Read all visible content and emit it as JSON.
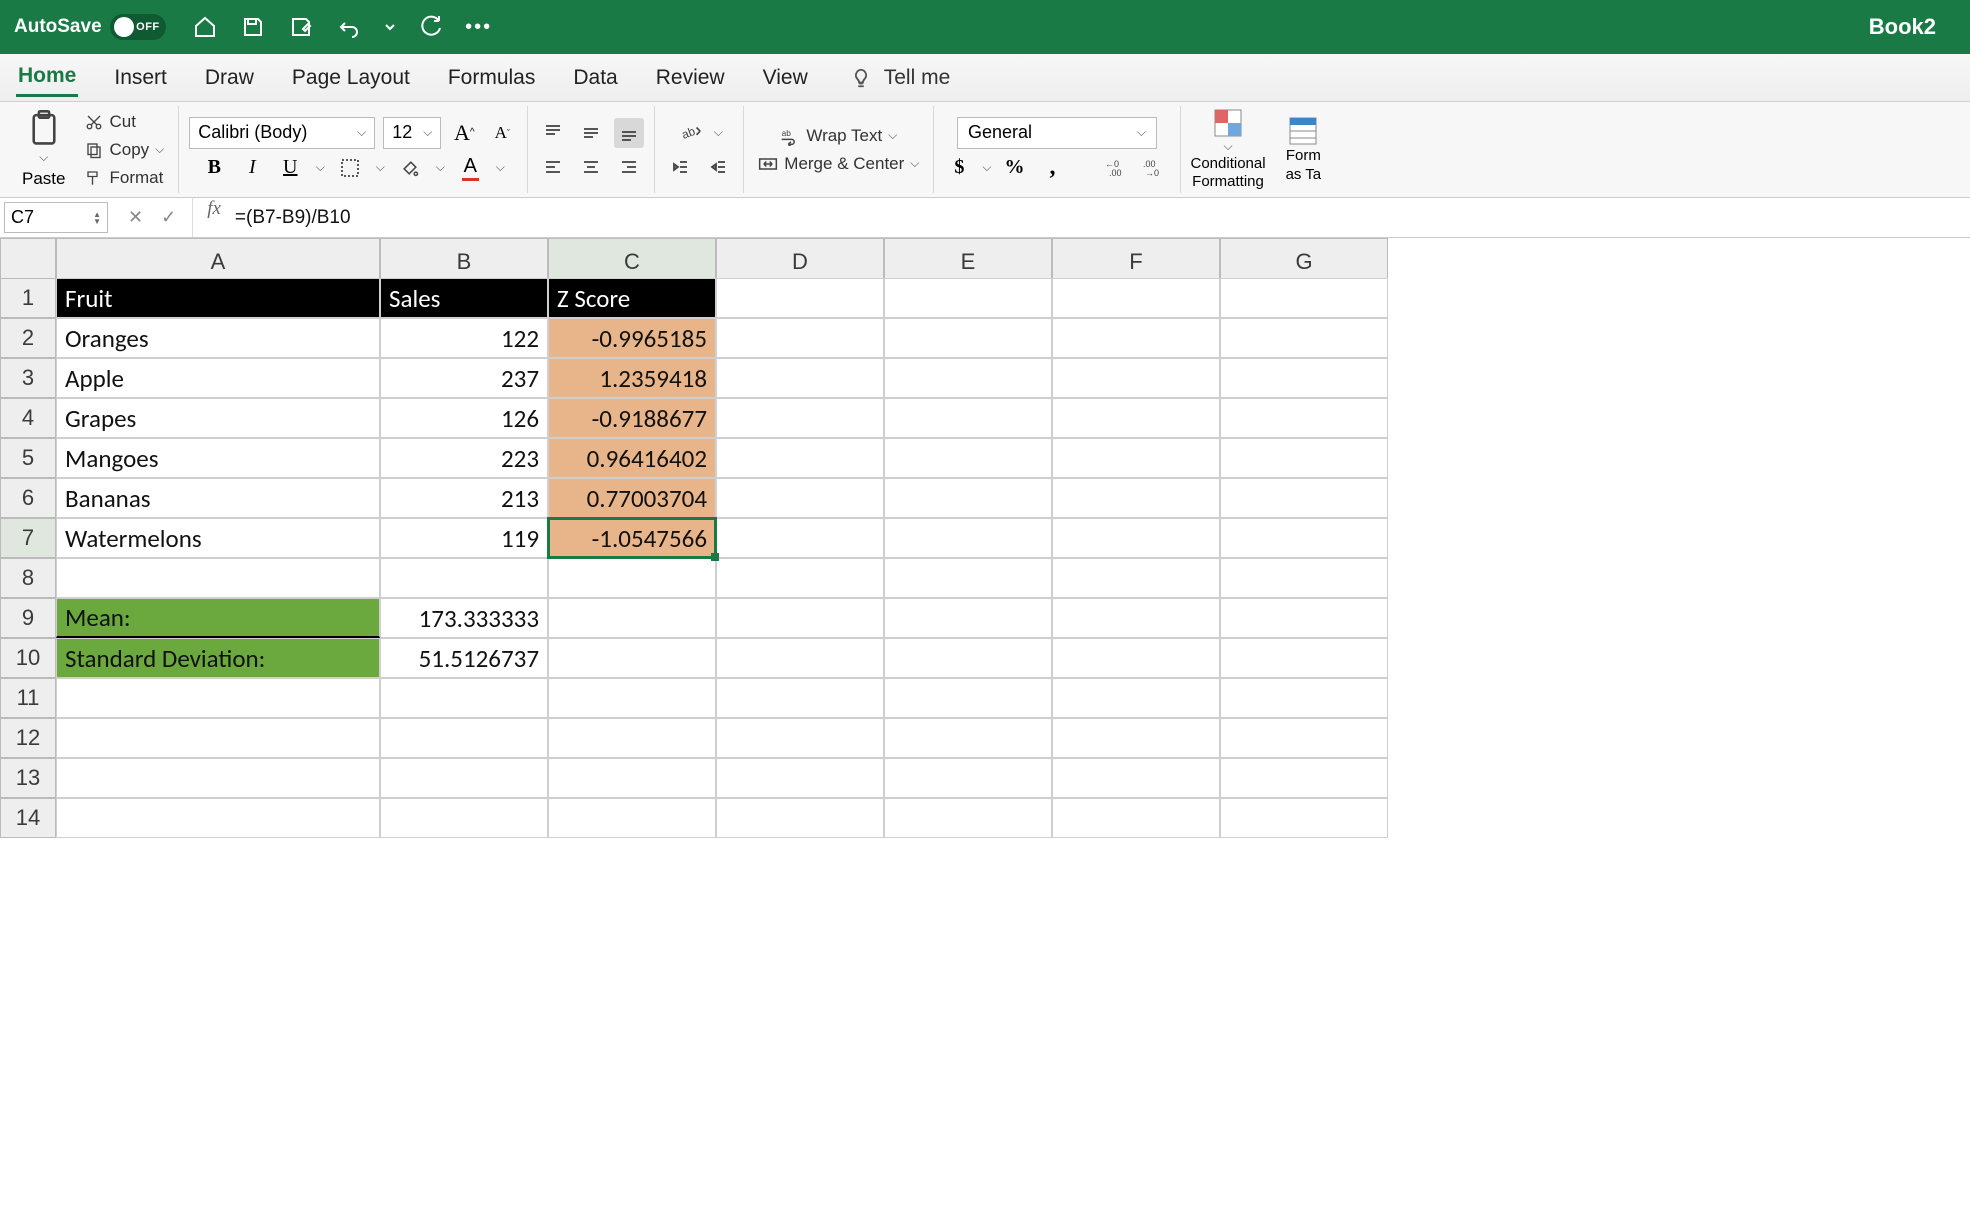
{
  "titlebar": {
    "autosave_label": "AutoSave",
    "autosave_state": "OFF",
    "book_title": "Book2"
  },
  "tabs": {
    "items": [
      "Home",
      "Insert",
      "Draw",
      "Page Layout",
      "Formulas",
      "Data",
      "Review",
      "View"
    ],
    "active": "Home",
    "tell_me": "Tell me"
  },
  "ribbon": {
    "paste": "Paste",
    "cut": "Cut",
    "copy": "Copy",
    "format": "Format",
    "font_name": "Calibri (Body)",
    "font_size": "12",
    "wrap_text": "Wrap Text",
    "merge_center": "Merge & Center",
    "number_format": "General",
    "conditional_formatting_1": "Conditional",
    "conditional_formatting_2": "Formatting",
    "format_as_1": "Form",
    "format_as_2": "as Ta"
  },
  "formula_bar": {
    "cell_ref": "C7",
    "formula": "=(B7-B9)/B10"
  },
  "sheet": {
    "columns": [
      "A",
      "B",
      "C",
      "D",
      "E",
      "F",
      "G"
    ],
    "selected_col": "C",
    "selected_row": "7",
    "header": {
      "a": "Fruit",
      "b": "Sales",
      "c": "Z Score"
    },
    "rows": [
      {
        "n": "2",
        "a": "Oranges",
        "b": "122",
        "c": "-0.9965185"
      },
      {
        "n": "3",
        "a": "Apple",
        "b": "237",
        "c": "1.2359418"
      },
      {
        "n": "4",
        "a": "Grapes",
        "b": "126",
        "c": "-0.9188677"
      },
      {
        "n": "5",
        "a": "Mangoes",
        "b": "223",
        "c": "0.96416402"
      },
      {
        "n": "6",
        "a": "Bananas",
        "b": "213",
        "c": "0.77003704"
      },
      {
        "n": "7",
        "a": "Watermelons",
        "b": "119",
        "c": "-1.0547566"
      }
    ],
    "stats": {
      "mean_label": "Mean:",
      "mean_value": "173.333333",
      "std_label": "Standard Deviation:",
      "std_value": "51.5126737"
    },
    "empty_rows": [
      "8",
      "11",
      "12",
      "13",
      "14"
    ]
  },
  "chart_data": {
    "type": "table",
    "title": "Fruit Sales and Z Scores",
    "columns": [
      "Fruit",
      "Sales",
      "Z Score"
    ],
    "records": [
      {
        "Fruit": "Oranges",
        "Sales": 122,
        "Z Score": -0.9965185
      },
      {
        "Fruit": "Apple",
        "Sales": 237,
        "Z Score": 1.2359418
      },
      {
        "Fruit": "Grapes",
        "Sales": 126,
        "Z Score": -0.9188677
      },
      {
        "Fruit": "Mangoes",
        "Sales": 223,
        "Z Score": 0.96416402
      },
      {
        "Fruit": "Bananas",
        "Sales": 213,
        "Z Score": 0.77003704
      },
      {
        "Fruit": "Watermelons",
        "Sales": 119,
        "Z Score": -1.0547566
      }
    ],
    "summary": {
      "Mean": 173.333333,
      "Standard Deviation": 51.5126737
    }
  }
}
